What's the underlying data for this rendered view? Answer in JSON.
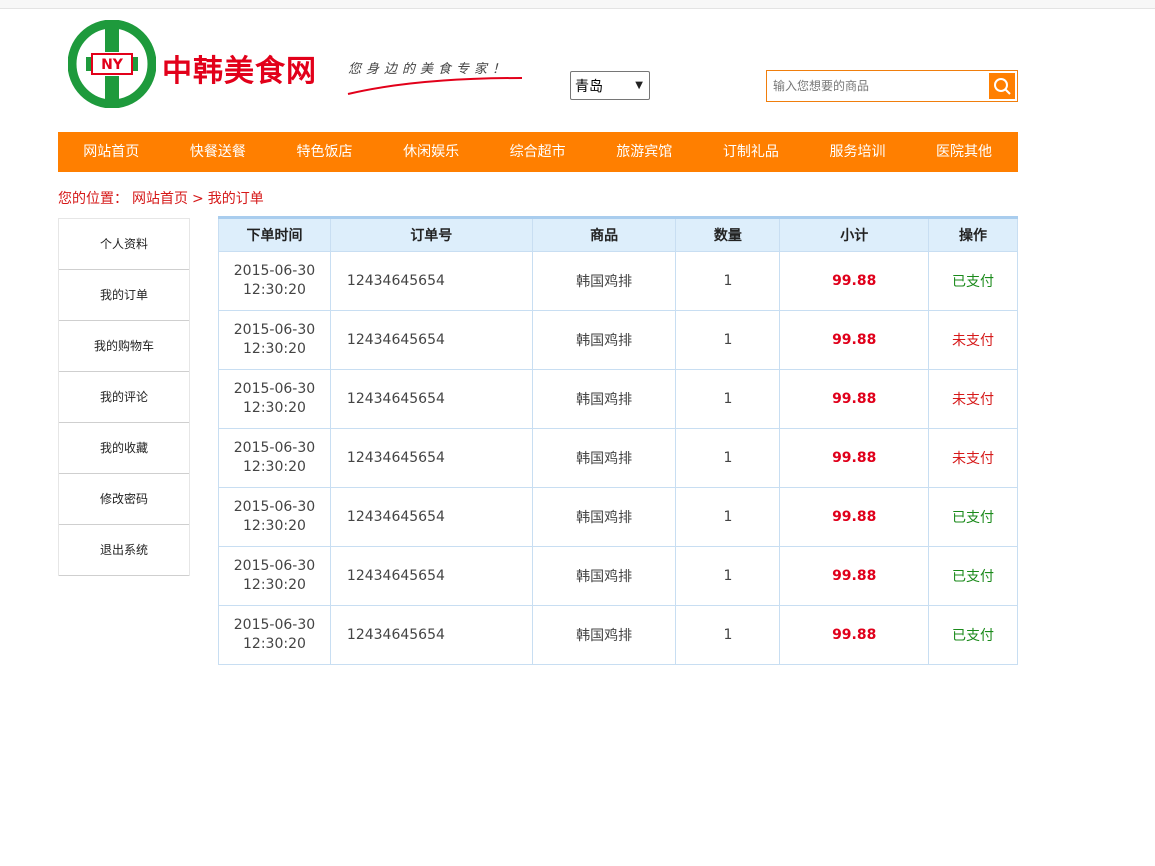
{
  "header": {
    "brand_name": "中韩美食网",
    "slogan": "您身边的美食专家！",
    "logo_letters": "NY",
    "city_select": "青岛",
    "search_placeholder": "输入您想要的商品"
  },
  "nav": [
    "网站首页",
    "快餐送餐",
    "特色饭店",
    "休闲娱乐",
    "综合超市",
    "旅游宾馆",
    "订制礼品",
    "服务培训",
    "医院其他"
  ],
  "breadcrumb": {
    "prefix": "您的位置：",
    "home": "网站首页",
    "sep": ">",
    "current": "我的订单"
  },
  "sidebar": [
    "个人资料",
    "我的订单",
    "我的购物车",
    "我的评论",
    "我的收藏",
    "修改密码",
    "退出系统"
  ],
  "table": {
    "headers": [
      "下单时间",
      "订单号",
      "商品",
      "数量",
      "小计",
      "操作"
    ],
    "rows": [
      {
        "date": "2015-06-30",
        "time": "12:30:20",
        "order_no": "12434645654",
        "product": "韩国鸡排",
        "qty": "1",
        "subtotal": "99.88",
        "status": "已支付",
        "paid": true
      },
      {
        "date": "2015-06-30",
        "time": "12:30:20",
        "order_no": "12434645654",
        "product": "韩国鸡排",
        "qty": "1",
        "subtotal": "99.88",
        "status": "未支付",
        "paid": false
      },
      {
        "date": "2015-06-30",
        "time": "12:30:20",
        "order_no": "12434645654",
        "product": "韩国鸡排",
        "qty": "1",
        "subtotal": "99.88",
        "status": "未支付",
        "paid": false
      },
      {
        "date": "2015-06-30",
        "time": "12:30:20",
        "order_no": "12434645654",
        "product": "韩国鸡排",
        "qty": "1",
        "subtotal": "99.88",
        "status": "未支付",
        "paid": false
      },
      {
        "date": "2015-06-30",
        "time": "12:30:20",
        "order_no": "12434645654",
        "product": "韩国鸡排",
        "qty": "1",
        "subtotal": "99.88",
        "status": "已支付",
        "paid": true
      },
      {
        "date": "2015-06-30",
        "time": "12:30:20",
        "order_no": "12434645654",
        "product": "韩国鸡排",
        "qty": "1",
        "subtotal": "99.88",
        "status": "已支付",
        "paid": true
      },
      {
        "date": "2015-06-30",
        "time": "12:30:20",
        "order_no": "12434645654",
        "product": "韩国鸡排",
        "qty": "1",
        "subtotal": "99.88",
        "status": "已支付",
        "paid": true
      }
    ]
  },
  "colors": {
    "accent": "#ff7f00",
    "brand_red": "#e2001a",
    "paid_green": "#1a8a1a",
    "unpaid_red": "#d61919",
    "logo_green": "#1e9a3c"
  },
  "icons": {
    "search": "search-icon",
    "dropdown": "chevron-down-icon"
  }
}
